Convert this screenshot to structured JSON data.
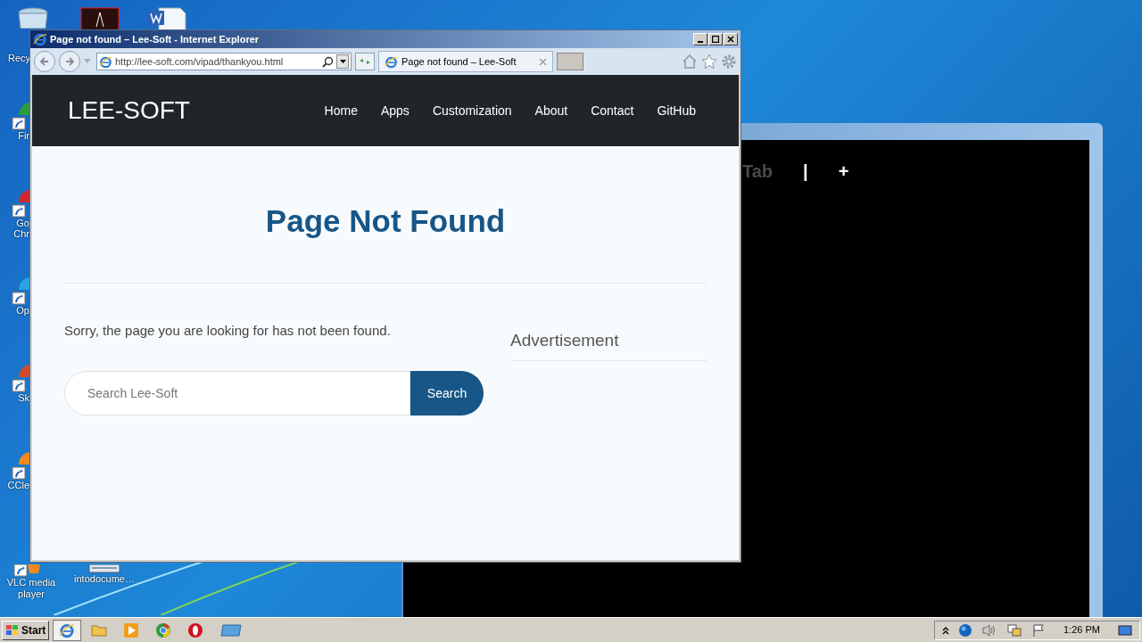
{
  "desktop": {
    "icons": [
      {
        "label": "Recy",
        "kind": "bin"
      },
      {
        "label": "Fir",
        "kind": "app"
      },
      {
        "label": "Go Chr",
        "kind": "app"
      },
      {
        "label": "Op",
        "kind": "app"
      },
      {
        "label": "Sk",
        "kind": "app"
      },
      {
        "label": "CCle",
        "kind": "app"
      },
      {
        "label": "VLC media player",
        "kind": "lower"
      }
    ],
    "file_icon": {
      "label": "intodocume…"
    }
  },
  "back_window": {
    "tab_label": "Tab",
    "separator": "|",
    "new_tab": "+"
  },
  "browser": {
    "title": "Page not found – Lee-Soft - Internet Explorer",
    "address": "http://lee-soft.com/vipad/thankyou.html",
    "tab": {
      "label": "Page not found – Lee-Soft",
      "selected": true
    },
    "site": {
      "logo": "LEE-SOFT",
      "nav": [
        "Home",
        "Apps",
        "Customization",
        "About",
        "Contact",
        "GitHub"
      ],
      "heading": "Page Not Found",
      "message": "Sorry, the page you are looking for has not been found.",
      "search": {
        "placeholder": "Search Lee-Soft",
        "button": "Search"
      },
      "sidebar_title": "Advertisement"
    }
  },
  "taskbar": {
    "start": "Start",
    "apps": [
      {
        "kind": "ie",
        "selected": true
      },
      {
        "kind": "folder",
        "selected": false
      },
      {
        "kind": "media",
        "selected": false
      },
      {
        "kind": "chrome",
        "selected": false
      },
      {
        "kind": "opera",
        "selected": false
      },
      {
        "kind": "window",
        "selected": false
      }
    ],
    "clock": "1:26 PM"
  }
}
